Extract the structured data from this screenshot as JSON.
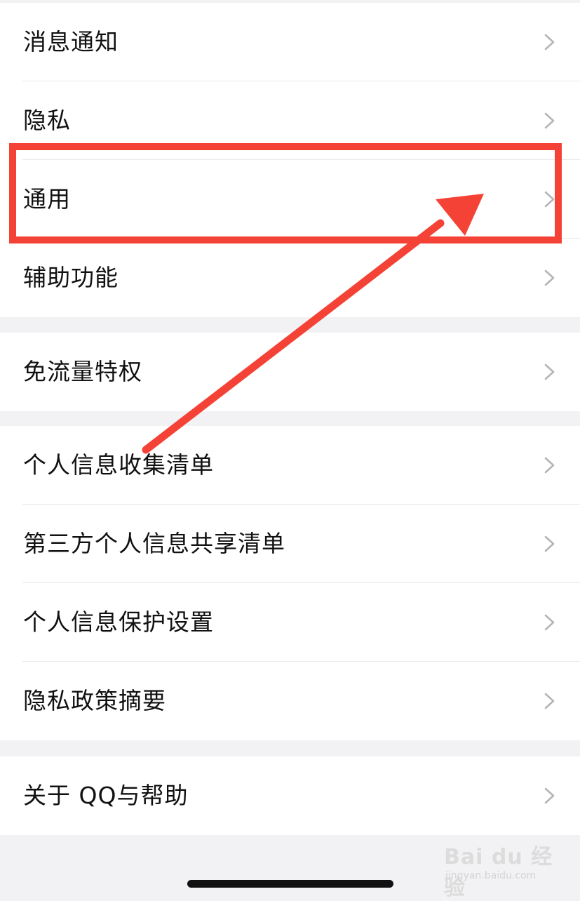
{
  "settings": {
    "group1": [
      "消息通知",
      "隐私",
      "通用",
      "辅助功能"
    ],
    "group2": [
      "免流量特权"
    ],
    "group3": [
      "个人信息收集清单",
      "第三方个人信息共享清单",
      "个人信息保护设置",
      "隐私政策摘要"
    ],
    "group4": [
      "关于 QQ与帮助"
    ]
  },
  "icons": {
    "row_arrow": "chevron-right-icon"
  },
  "colors": {
    "background": "#f2f2f5",
    "row_background": "#ffffff",
    "annotation_red": "#f44336",
    "chevron": "#b5b5b8"
  },
  "annotation": {
    "highlighted_item": "通用"
  },
  "watermark": {
    "brand": "Bai du 经验",
    "site": "jingyan.baidu.com"
  }
}
